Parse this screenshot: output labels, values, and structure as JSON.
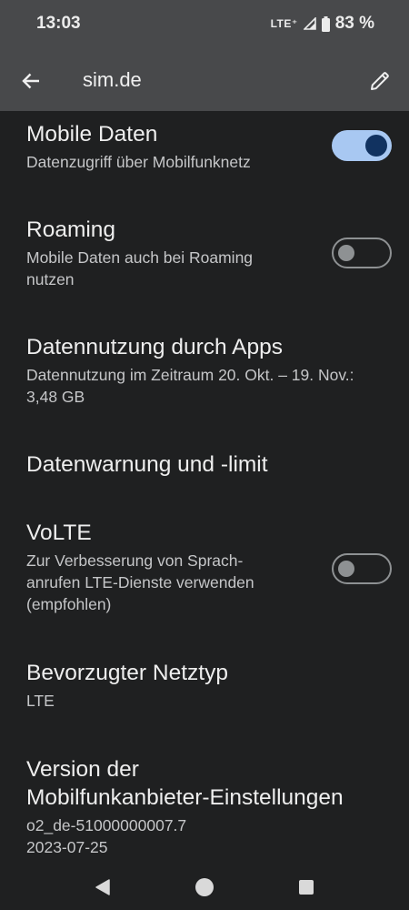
{
  "status_bar": {
    "time": "13:03",
    "network": "LTE⁺",
    "battery": "83 %"
  },
  "app_bar": {
    "title": "sim.de",
    "back_icon": "arrow-back-icon",
    "edit_icon": "pencil-icon"
  },
  "settings": [
    {
      "title": "Mobile Daten",
      "summary": "Datenzugriff über Mobilfunknetz",
      "toggle": "on"
    },
    {
      "title": "Roaming",
      "summary_lines": [
        "Mobile Daten auch bei Roaming",
        "nutzen"
      ],
      "toggle": "off"
    },
    {
      "title": "Datennutzung durch Apps",
      "summary_lines": [
        "Datennutzung im Zeitraum 20. Okt. – 19. Nov.:",
        "3,48 GB"
      ]
    },
    {
      "title": "Datenwarnung und -limit"
    },
    {
      "title": "VoLTE",
      "summary_lines": [
        "Zur Verbesserung von Sprach-",
        "anrufen LTE-Dienste verwenden",
        "(empfohlen)"
      ],
      "toggle": "off"
    },
    {
      "title": "Bevorzugter Netztyp",
      "summary": "LTE"
    },
    {
      "title_lines": [
        "Version der",
        "Mobilfunkanbieter-Einstellungen"
      ],
      "summary_lines": [
        "o2_de-51000000007.7",
        "2023-07-25"
      ]
    }
  ],
  "nav_bar": {
    "back": "triangle-back-icon",
    "home": "circle-home-icon",
    "recents": "square-recents-icon"
  },
  "colors": {
    "surface": "#1f2021",
    "toolbar": "#48494b",
    "toggle_on_track": "#a8c8f2",
    "toggle_on_thumb": "#113260",
    "toggle_off_outline": "#8e9193"
  }
}
